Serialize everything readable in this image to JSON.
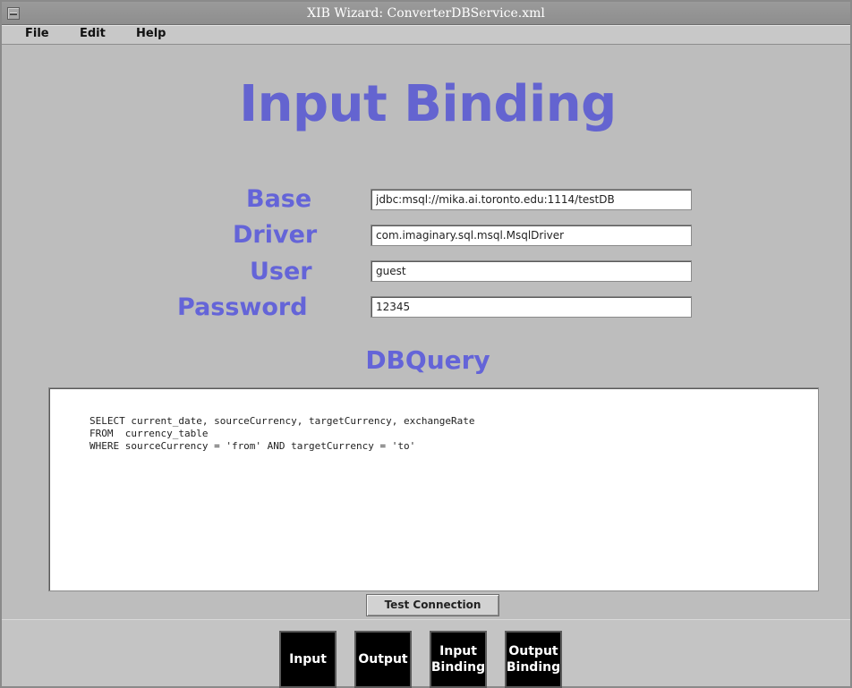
{
  "window": {
    "title": "XIB Wizard: ConverterDBService.xml"
  },
  "menu": {
    "file": "File",
    "edit": "Edit",
    "help": "Help"
  },
  "page": {
    "heading": "Input Binding"
  },
  "form": {
    "base_label": "Base",
    "base_value": "jdbc:msql://mika.ai.toronto.edu:1114/testDB",
    "driver_label": "Driver",
    "driver_value": "com.imaginary.sql.msql.MsqlDriver",
    "user_label": "User",
    "user_value": "guest",
    "password_label": "Password",
    "password_value": "12345"
  },
  "query": {
    "heading": "DBQuery",
    "text": "SELECT current_date, sourceCurrency, targetCurrency, exchangeRate\nFROM  currency_table\nWHERE sourceCurrency = 'from' AND targetCurrency = 'to'"
  },
  "actions": {
    "test_connection": "Test Connection"
  },
  "nav": {
    "input": "Input",
    "output": "Output",
    "input_binding_line1": "Input",
    "input_binding_line2": "Binding",
    "output_binding_line1": "Output",
    "output_binding_line2": "Binding"
  },
  "colors": {
    "label": "#6464d8",
    "window_bg": "#bdbdbd",
    "nav_button_bg": "#000000"
  }
}
